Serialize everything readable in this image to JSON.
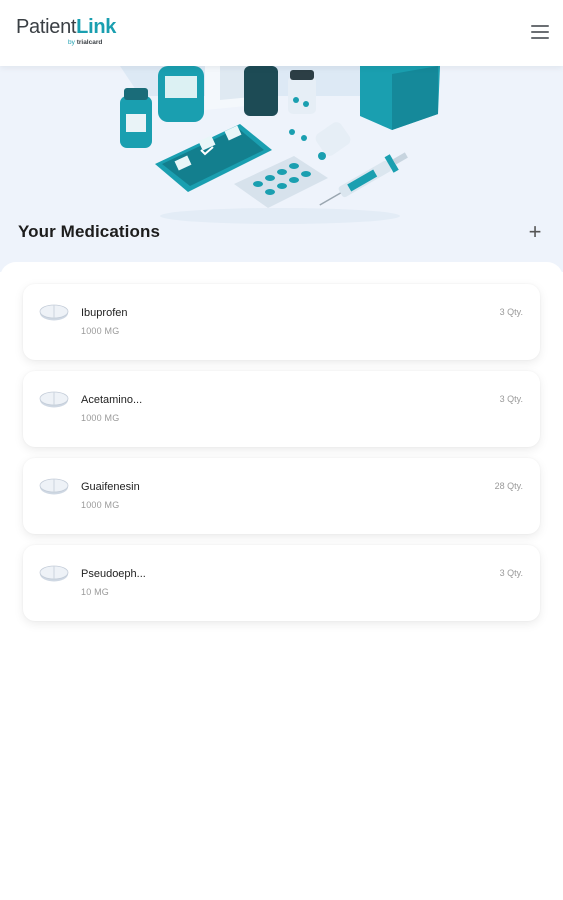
{
  "header": {
    "logo_patient": "Patient",
    "logo_link": "Link",
    "logo_by": "by",
    "logo_brand": "trialcard",
    "menu_icon": "hamburger-menu-icon"
  },
  "section": {
    "title": "Your Medications",
    "add_label": "+"
  },
  "medications": [
    {
      "name": "Ibuprofen",
      "dose": "1000 MG",
      "qty": "3 Qty."
    },
    {
      "name": "Acetamino...",
      "dose": "1000 MG",
      "qty": "3 Qty."
    },
    {
      "name": "Guaifenesin",
      "dose": "1000 MG",
      "qty": "28 Qty."
    },
    {
      "name": "Pseudoeph...",
      "dose": "10 MG",
      "qty": "3 Qty."
    }
  ],
  "colors": {
    "accent": "#1a9fb0",
    "hero_bg": "#eef3fb"
  }
}
